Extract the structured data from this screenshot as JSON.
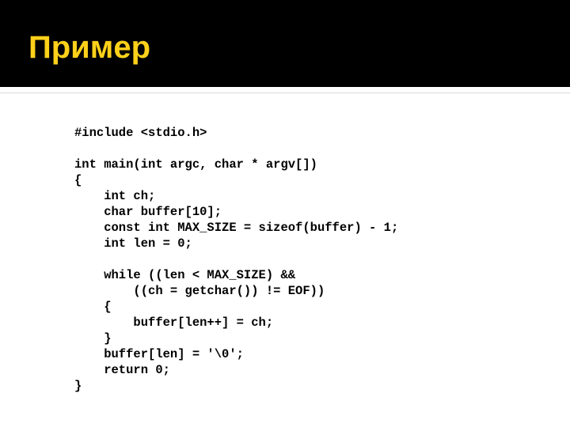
{
  "slide": {
    "title": "Пример",
    "title_color": "#ffd11a",
    "band_color": "#000000",
    "background_color": "#ffffff",
    "code": "#include <stdio.h>\n\nint main(int argc, char * argv[])\n{\n    int ch;\n    char buffer[10];\n    const int MAX_SIZE = sizeof(buffer) - 1;\n    int len = 0;\n\n    while ((len < MAX_SIZE) &&\n        ((ch = getchar()) != EOF))\n    {\n        buffer[len++] = ch;\n    }\n    buffer[len] = '\\0';\n    return 0;\n}",
    "code_lines": [
      "#include <stdio.h>",
      "",
      "int main(int argc, char * argv[])",
      "{",
      "    int ch;",
      "    char buffer[10];",
      "    const int MAX_SIZE = sizeof(buffer) - 1;",
      "    int len = 0;",
      "",
      "    while ((len < MAX_SIZE) &&",
      "        ((ch = getchar()) != EOF))",
      "    {",
      "        buffer[len++] = ch;",
      "    }",
      "    buffer[len] = '\\0';",
      "    return 0;",
      "}"
    ]
  }
}
